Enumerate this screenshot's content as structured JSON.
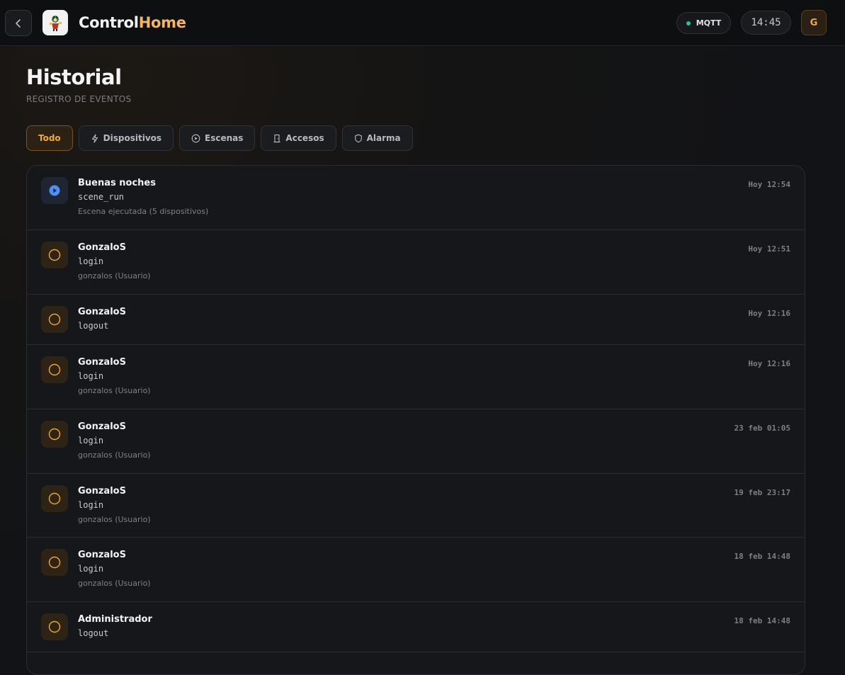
{
  "header": {
    "brand_primary": "Control",
    "brand_secondary": "Home",
    "mqtt_label": "MQTT",
    "clock": "14:45",
    "avatar_initial": "G"
  },
  "page": {
    "title": "Historial",
    "subtitle": "REGISTRO DE EVENTOS"
  },
  "filters": [
    {
      "label": "Todo",
      "icon": "none",
      "active": true
    },
    {
      "label": "Dispositivos",
      "icon": "bolt-icon",
      "active": false
    },
    {
      "label": "Escenas",
      "icon": "play-circle-icon",
      "active": false
    },
    {
      "label": "Accesos",
      "icon": "door-icon",
      "active": false
    },
    {
      "label": "Alarma",
      "icon": "shield-icon",
      "active": false
    }
  ],
  "events": [
    {
      "title": "Buenas noches",
      "action": "scene_run",
      "detail": "Escena ejecutada (5 dispositivos)",
      "time": "Hoy 12:54",
      "icon": "play-circle-icon",
      "color": "#4f8ff7"
    },
    {
      "title": "GonzaloS",
      "action": "login",
      "detail": "gonzalos (Usuario)",
      "time": "Hoy 12:51",
      "icon": "circle-icon",
      "color": "#f0a43a"
    },
    {
      "title": "GonzaloS",
      "action": "logout",
      "detail": "",
      "time": "Hoy 12:16",
      "icon": "circle-icon",
      "color": "#f0a43a"
    },
    {
      "title": "GonzaloS",
      "action": "login",
      "detail": "gonzalos (Usuario)",
      "time": "Hoy 12:16",
      "icon": "circle-icon",
      "color": "#f0a43a"
    },
    {
      "title": "GonzaloS",
      "action": "login",
      "detail": "gonzalos (Usuario)",
      "time": "23 feb 01:05",
      "icon": "circle-icon",
      "color": "#f0a43a"
    },
    {
      "title": "GonzaloS",
      "action": "login",
      "detail": "gonzalos (Usuario)",
      "time": "19 feb 23:17",
      "icon": "circle-icon",
      "color": "#f0a43a"
    },
    {
      "title": "GonzaloS",
      "action": "login",
      "detail": "gonzalos (Usuario)",
      "time": "18 feb 14:48",
      "icon": "circle-icon",
      "color": "#f0a43a"
    },
    {
      "title": "Administrador",
      "action": "logout",
      "detail": "",
      "time": "18 feb 14:48",
      "icon": "circle-icon",
      "color": "#f0a43a"
    }
  ],
  "colors": {
    "accent": "#f5b563",
    "online": "#22c58b"
  }
}
